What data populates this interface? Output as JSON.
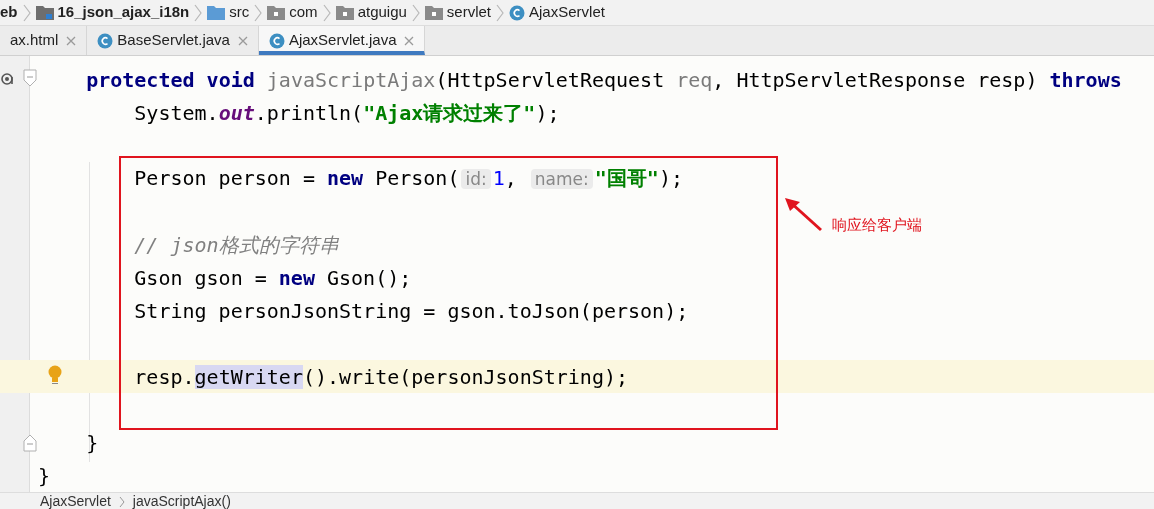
{
  "breadcrumbs": [
    {
      "kind": "text",
      "label": "eb"
    },
    {
      "kind": "module",
      "label": "16_json_ajax_i18n"
    },
    {
      "kind": "folder",
      "label": "src"
    },
    {
      "kind": "package",
      "label": "com"
    },
    {
      "kind": "package",
      "label": "atguigu"
    },
    {
      "kind": "package",
      "label": "servlet"
    },
    {
      "kind": "class",
      "label": "AjaxServlet"
    }
  ],
  "tabs": [
    {
      "label": "ax.html",
      "kind": "file",
      "selected": false
    },
    {
      "label": "BaseServlet.java",
      "kind": "class",
      "selected": false
    },
    {
      "label": "AjaxServlet.java",
      "kind": "class",
      "selected": true
    }
  ],
  "code": [
    {
      "kind": "override-fold",
      "current": false,
      "tokens": [
        {
          "kind": "kw",
          "text": "    protected"
        },
        {
          "kind": "kw",
          "text": " void"
        },
        {
          "kind": "unused",
          "text": " javaScriptAjax"
        },
        {
          "kind": "plain",
          "text": "(HttpServletRequest "
        },
        {
          "kind": "unused",
          "text": "req"
        },
        {
          "kind": "plain",
          "text": ", HttpServletResponse resp) "
        },
        {
          "kind": "kw",
          "text": "throws"
        }
      ]
    },
    {
      "kind": "plain",
      "current": false,
      "tokens": [
        {
          "kind": "plain",
          "text": "        System."
        },
        {
          "kind": "static",
          "text": "out"
        },
        {
          "kind": "plain",
          "text": ".println("
        },
        {
          "kind": "str",
          "text": "\"Ajax请求过来了\""
        },
        {
          "kind": "plain",
          "text": ");"
        }
      ]
    },
    {
      "kind": "blank",
      "current": false
    },
    {
      "kind": "plain",
      "current": false,
      "tokens": [
        {
          "kind": "plain",
          "text": "        Person person = "
        },
        {
          "kind": "kw",
          "text": "new"
        },
        {
          "kind": "plain",
          "text": " Person("
        },
        {
          "kind": "hint",
          "text": "id:"
        },
        {
          "kind": "num",
          "text": "1"
        },
        {
          "kind": "plain",
          "text": ", "
        },
        {
          "kind": "hint",
          "text": "name:"
        },
        {
          "kind": "str",
          "text": "\"国哥\""
        },
        {
          "kind": "plain",
          "text": ");"
        }
      ]
    },
    {
      "kind": "blank",
      "current": false
    },
    {
      "kind": "plain",
      "current": false,
      "tokens": [
        {
          "kind": "comment",
          "text": "        // json格式的字符串"
        }
      ]
    },
    {
      "kind": "plain",
      "current": false,
      "tokens": [
        {
          "kind": "plain",
          "text": "        Gson gson = "
        },
        {
          "kind": "kw",
          "text": "new"
        },
        {
          "kind": "plain",
          "text": " Gson();"
        }
      ]
    },
    {
      "kind": "plain",
      "current": false,
      "tokens": [
        {
          "kind": "plain",
          "text": "        String personJsonString = gson.toJson(person);"
        }
      ]
    },
    {
      "kind": "blank",
      "current": false
    },
    {
      "kind": "bulb",
      "current": true,
      "tokens": [
        {
          "kind": "plain",
          "text": "        resp."
        },
        {
          "kind": "match",
          "text": "getWriter"
        },
        {
          "kind": "plain",
          "text": "().write(personJsonString);"
        }
      ]
    },
    {
      "kind": "blank",
      "current": false
    },
    {
      "kind": "fold-end",
      "current": false,
      "tokens": [
        {
          "kind": "plain",
          "text": "    }"
        }
      ]
    },
    {
      "kind": "plain",
      "current": false,
      "tokens": [
        {
          "kind": "plain",
          "text": "}"
        }
      ]
    }
  ],
  "annotation": {
    "label": "响应给客户端"
  },
  "status_breadcrumbs": [
    "AjaxServlet",
    "javaScriptAjax()"
  ]
}
